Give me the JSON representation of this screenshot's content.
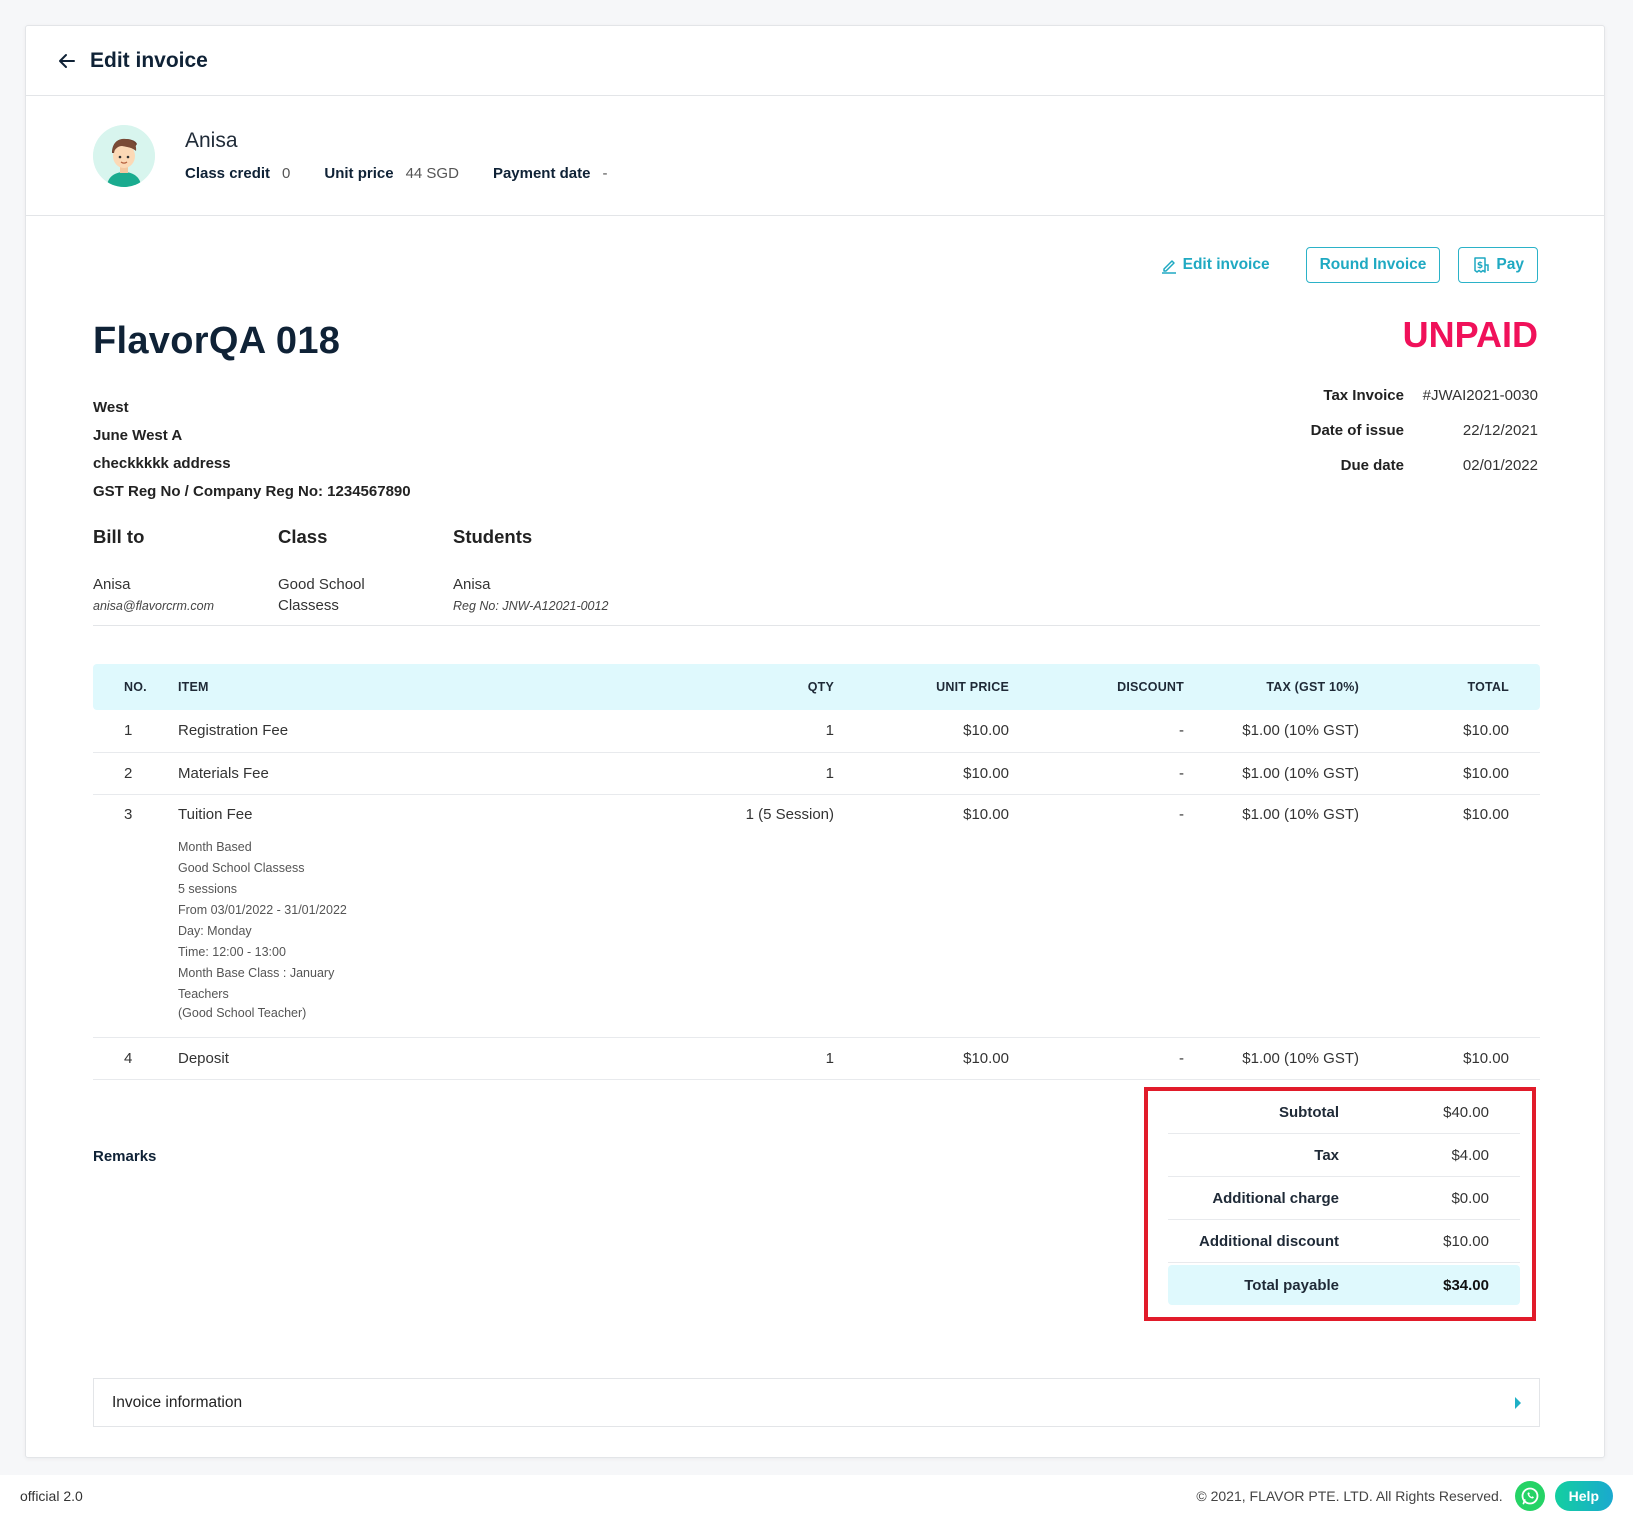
{
  "header": {
    "title": "Edit invoice",
    "back_icon": "arrow-left-icon"
  },
  "profile": {
    "name": "Anisa",
    "avatar": "student-avatar",
    "meta": [
      {
        "label": "Class credit",
        "value": "0"
      },
      {
        "label": "Unit price",
        "value": "44 SGD"
      },
      {
        "label": "Payment date",
        "value": "-"
      }
    ]
  },
  "actions": {
    "edit_label": "Edit invoice",
    "round_label": "Round Invoice",
    "pay_label": "Pay"
  },
  "invoice": {
    "company_name": "FlavorQA 018",
    "status": "UNPAID",
    "status_color": "#f0115a",
    "company_lines": [
      "West",
      "June West A",
      "checkkkkk address",
      "GST Reg No / Company Reg No: 1234567890"
    ],
    "meta": [
      {
        "label": "Tax Invoice",
        "value": "#JWAI2021-0030"
      },
      {
        "label": "Date of issue",
        "value": "22/12/2021"
      },
      {
        "label": "Due date",
        "value": "02/01/2022"
      }
    ]
  },
  "parties": {
    "bill_to": {
      "title": "Bill to",
      "name": "Anisa",
      "email": "anisa@flavorcrm.com"
    },
    "class": {
      "title": "Class",
      "name_line1": "Good School",
      "name_line2": "Classess"
    },
    "students": {
      "title": "Students",
      "name": "Anisa",
      "reg": "Reg No: JNW-A12021-0012"
    }
  },
  "table": {
    "columns": [
      "NO.",
      "ITEM",
      "QTY",
      "UNIT PRICE",
      "DISCOUNT",
      "TAX (GST 10%)",
      "TOTAL"
    ],
    "rows": [
      {
        "no": "1",
        "item": "Registration Fee",
        "qty": "1",
        "unit_price": "$10.00",
        "discount": "-",
        "tax": "$1.00 (10% GST)",
        "total": "$10.00"
      },
      {
        "no": "2",
        "item": "Materials Fee",
        "qty": "1",
        "unit_price": "$10.00",
        "discount": "-",
        "tax": "$1.00 (10% GST)",
        "total": "$10.00"
      },
      {
        "no": "3",
        "item": "Tuition Fee",
        "qty": "1 (5 Session)",
        "unit_price": "$10.00",
        "discount": "-",
        "tax": "$1.00 (10% GST)",
        "total": "$10.00",
        "details": [
          "Month Based",
          "Good School Classess",
          "5 sessions",
          "From 03/01/2022 - 31/01/2022",
          "Day: Monday",
          "Time: 12:00 - 13:00",
          "Month Base Class : January",
          "Teachers",
          "(Good School Teacher)"
        ]
      },
      {
        "no": "4",
        "item": "Deposit",
        "qty": "1",
        "unit_price": "$10.00",
        "discount": "-",
        "tax": "$1.00 (10% GST)",
        "total": "$10.00"
      }
    ]
  },
  "remarks_label": "Remarks",
  "summary": {
    "rows": [
      {
        "label": "Subtotal",
        "value": "$40.00"
      },
      {
        "label": "Tax",
        "value": "$4.00"
      },
      {
        "label": "Additional charge",
        "value": "$0.00"
      },
      {
        "label": "Additional discount",
        "value": "$10.00"
      }
    ],
    "total_label": "Total payable",
    "total_value": "$34.00",
    "highlight_color": "#e11b2a"
  },
  "info_panel": {
    "label": "Invoice information"
  },
  "footer": {
    "version": "official 2.0",
    "copyright": "© 2021, FLAVOR PTE. LTD. All Rights Reserved.",
    "help_label": "Help"
  }
}
